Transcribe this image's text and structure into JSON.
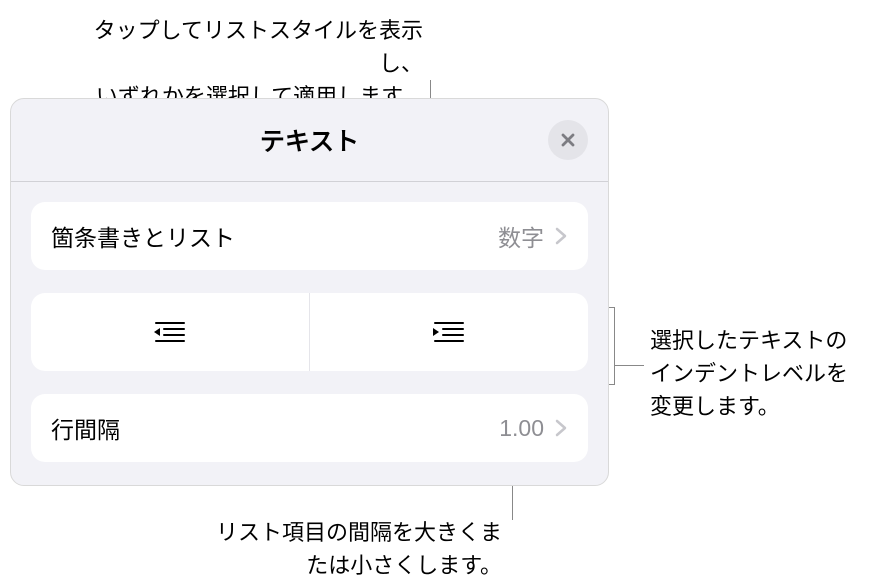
{
  "callouts": {
    "top": "タップしてリストスタイルを表示し、\nいずれかを選択して適用します。",
    "right": "選択したテキストの\nインデントレベルを\n変更します。",
    "bottom": "リスト項目の間隔を大きくま\nたは小さくします。"
  },
  "panel": {
    "title": "テキスト"
  },
  "list_style": {
    "label": "箇条書きとリスト",
    "value": "数字"
  },
  "line_spacing": {
    "label": "行間隔",
    "value": "1.00"
  }
}
